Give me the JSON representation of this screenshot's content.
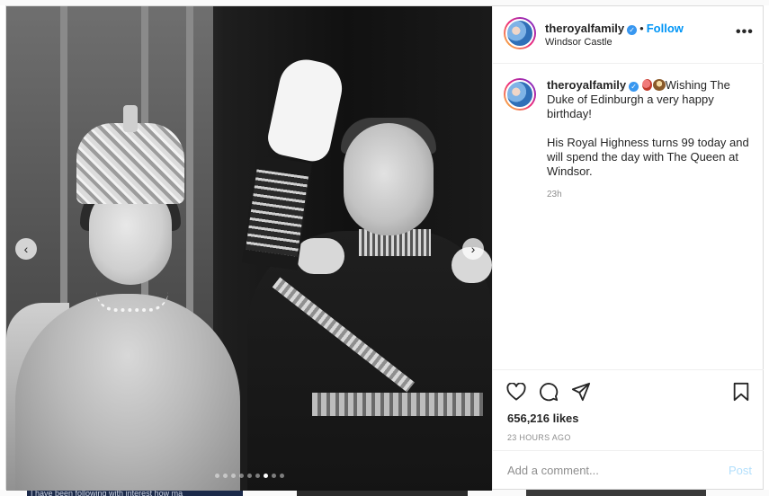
{
  "post": {
    "username": "theroyalfamily",
    "location": "Windsor Castle",
    "follow_label": "Follow",
    "separator": "•",
    "more_icon": "•••",
    "caption_line1": "Wishing The Duke of Edinburgh a very happy birthday!",
    "caption_line2": "His Royal Highness turns 99 today and will spend the day with The Queen at Windsor.",
    "comment_time": "23h",
    "likes": "656,216 likes",
    "posted_ago": "23 HOURS AGO",
    "verified_mark": "✓"
  },
  "carousel": {
    "prev_icon": "‹",
    "next_icon": "›",
    "slide_count": 9,
    "active_index": 6
  },
  "comment_box": {
    "placeholder": "Add a comment...",
    "post_label": "Post"
  },
  "background": {
    "strip_text": "I have been following with interest how ma"
  },
  "colors": {
    "accent": "#0095f6",
    "verified": "#3897f0",
    "post_disabled": "#b2dffc"
  },
  "icons": [
    "heart-icon",
    "comment-icon",
    "share-icon",
    "bookmark-icon",
    "verified-badge-icon",
    "more-icon",
    "chevron-left-icon",
    "chevron-right-icon"
  ]
}
